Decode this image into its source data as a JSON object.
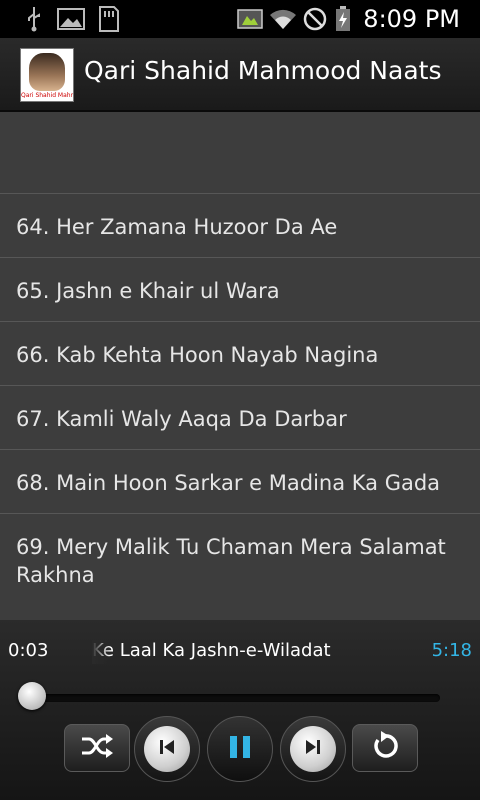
{
  "status_bar": {
    "time": "8:09 PM",
    "icons": [
      "usb-icon",
      "image-icon",
      "sd-card-icon",
      "screenshot-icon",
      "wifi-icon",
      "no-signal-icon",
      "battery-charging-icon"
    ]
  },
  "app": {
    "title": "Qari Shahid Mahmood Naats",
    "logo_caption": "Qari Shahid Mahmood Naats"
  },
  "list": {
    "items": [
      {
        "label": ""
      },
      {
        "label": "64. Her Zamana Huzoor Da Ae"
      },
      {
        "label": "65. Jashn e Khair ul Wara"
      },
      {
        "label": "66. Kab Kehta Hoon Nayab Nagina"
      },
      {
        "label": "67. Kamli Waly Aaqa Da Darbar"
      },
      {
        "label": "68. Main Hoon Sarkar e Madina Ka Gada"
      },
      {
        "label": "69. Mery Malik Tu Chaman Mera Salamat Rakhna"
      }
    ]
  },
  "player": {
    "elapsed": "0:03",
    "now_playing": "Ke Laal Ka Jashn-e-Wiladat",
    "total": "5:18",
    "progress_fraction": 0.01,
    "accent_color": "#33b5e5",
    "controls": [
      "shuffle-icon",
      "previous-icon",
      "pause-icon",
      "next-icon",
      "repeat-icon"
    ]
  }
}
